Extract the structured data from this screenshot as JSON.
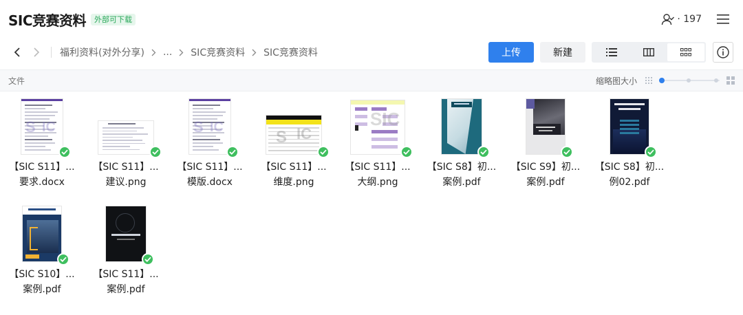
{
  "header": {
    "title": "SIC竞赛资料",
    "badge": "外部可下载",
    "member_count": "· 197"
  },
  "nav": {
    "breadcrumbs": [
      "福利资料(对外分享)",
      "...",
      "SIC竞赛资料",
      "SIC竞赛资料"
    ]
  },
  "toolbar": {
    "upload_label": "上传",
    "new_label": "新建"
  },
  "subbar": {
    "column_label": "文件",
    "thumb_size_label": "缩略图大小",
    "thumb_size_level": 0
  },
  "files": [
    {
      "line1": "【SIC S11】...",
      "line2": "要求.docx",
      "thumb": "doc-purple",
      "synced": true
    },
    {
      "line1": "【SIC S11】...",
      "line2": "建议.png",
      "thumb": "doc-plain",
      "synced": true
    },
    {
      "line1": "【SIC S11】...",
      "line2": "模版.docx",
      "thumb": "doc-purple",
      "synced": true
    },
    {
      "line1": "【SIC S11】...",
      "line2": "维度.png",
      "thumb": "table-yellow",
      "synced": true
    },
    {
      "line1": "【SIC S11】...",
      "line2": "大纲.png",
      "thumb": "outline",
      "synced": true
    },
    {
      "line1": "【SIC S8】初...",
      "line2": "案例.pdf",
      "thumb": "cover-teal",
      "synced": true
    },
    {
      "line1": "【SIC S9】初...",
      "line2": "案例.pdf",
      "thumb": "cover-gray",
      "synced": true
    },
    {
      "line1": "【SIC S8】初...",
      "line2": "例02.pdf",
      "thumb": "cover-navy",
      "synced": true
    },
    {
      "line1": "【SIC S10】...",
      "line2": "案例.pdf",
      "thumb": "cover-city",
      "synced": true
    },
    {
      "line1": "【SIC S11】...",
      "line2": "案例.pdf",
      "thumb": "cover-dark",
      "synced": true
    }
  ],
  "colors": {
    "primary": "#2f80ed",
    "badge_text": "#2aa85a",
    "badge_bg": "#e6f6ec",
    "synced": "#3fbf5f"
  }
}
